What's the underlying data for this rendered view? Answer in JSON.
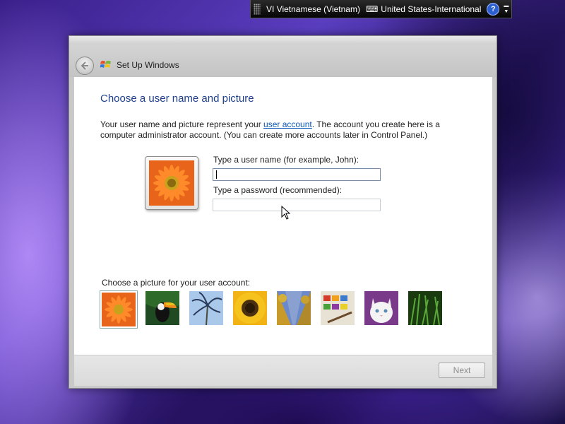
{
  "language_bar": {
    "language": "VI Vietnamese (Vietnam)",
    "keyboard": "United States-International",
    "help_icon": "help-icon",
    "help_glyph": "?"
  },
  "window": {
    "title": "Set Up Windows",
    "back_icon": "back-arrow-icon",
    "heading": "Choose a user name and picture",
    "description_before": "Your user name and picture represent your ",
    "description_link": "user account",
    "description_after": ". The account you create here is a computer administrator account. (You can create more accounts later in Control Panel.)",
    "username_label": "Type a user name (for example, John):",
    "username_value": "",
    "password_label": "Type a password (recommended):",
    "password_value": "",
    "pictures_label": "Choose a picture for your user account:",
    "pictures": [
      "orange-flower",
      "toucan",
      "palm-tree",
      "sunflower",
      "autumn-trees",
      "watercolors",
      "white-cat",
      "green-grass"
    ],
    "selected_picture": "orange-flower",
    "next_label": "Next"
  },
  "colors": {
    "heading": "#1e3f8a",
    "link": "#0b58b8",
    "disabled_text": "#8c8c8c"
  }
}
